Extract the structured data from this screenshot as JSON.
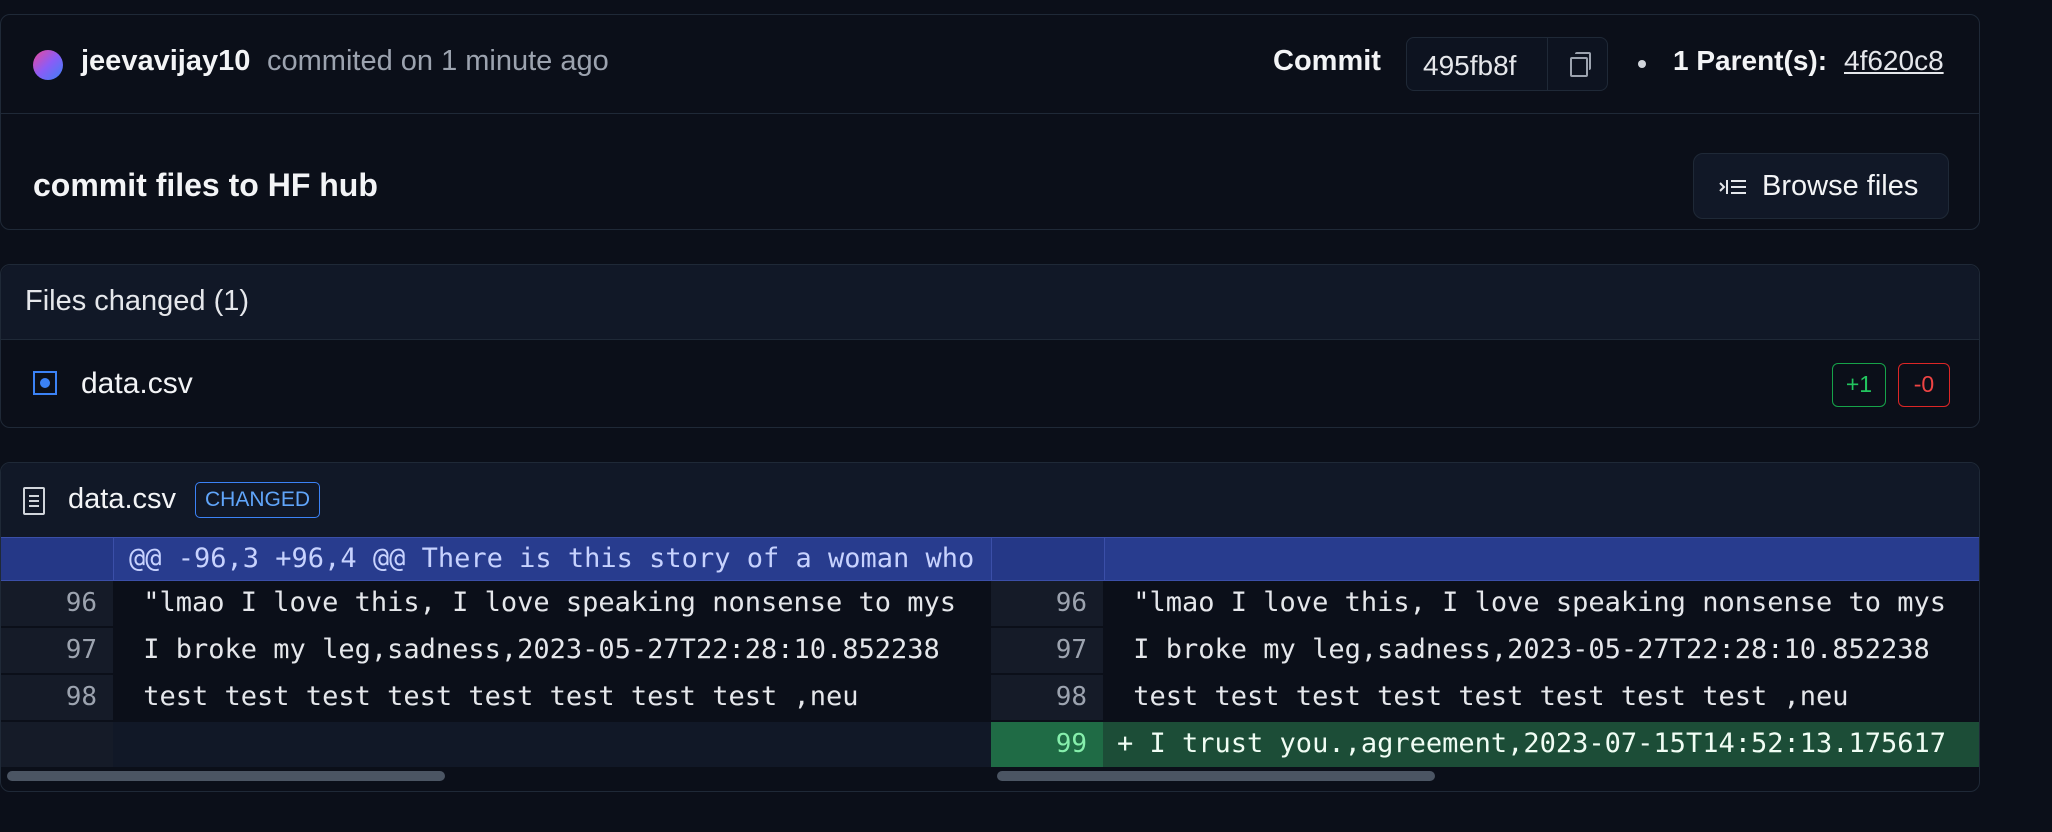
{
  "commit": {
    "author": "jeevavijay10",
    "committed_text": "commited on 1 minute ago",
    "commit_label": "Commit",
    "hash": "495fb8f",
    "parents_label": "1 Parent(s):",
    "parent_hash": "4f620c8",
    "message": "commit files to HF hub",
    "browse_label": "Browse files"
  },
  "files": {
    "title": "Files changed (1)",
    "items": [
      {
        "name": "data.csv",
        "additions": "+1",
        "deletions": "-0"
      }
    ]
  },
  "diff": {
    "file": "data.csv",
    "status": "CHANGED",
    "hunk": "@@ -96,3 +96,4 @@ There is this story of a woman who",
    "left": [
      {
        "num": "96",
        "text": " \"lmao I love this, I love speaking nonsense to mys"
      },
      {
        "num": "97",
        "text": " I broke my leg,sadness,2023-05-27T22:28:10.852238"
      },
      {
        "num": "98",
        "text": " test test test test test test test test ,neu"
      },
      {
        "num": "",
        "text": ""
      }
    ],
    "right": [
      {
        "num": "96",
        "text": " \"lmao I love this, I love speaking nonsense to mys"
      },
      {
        "num": "97",
        "text": " I broke my leg,sadness,2023-05-27T22:28:10.852238"
      },
      {
        "num": "98",
        "text": " test test test test test test test test ,neu"
      },
      {
        "num": "99",
        "text": "+ I trust you.,agreement,2023-07-15T14:52:13.175617"
      }
    ]
  },
  "icons": {
    "copy": "copy-icon",
    "browse": "browse-files-icon",
    "file": "file-icon",
    "doc": "document-icon"
  }
}
